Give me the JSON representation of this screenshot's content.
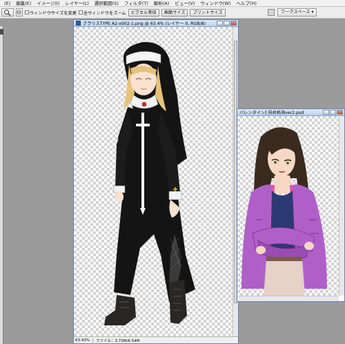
{
  "menubar": {
    "items": [
      "(E)",
      "編集(E)",
      "イメージ(I)",
      "レイヤー(L)",
      "選択範囲(S)",
      "フィルタ(T)",
      "解析(A)",
      "ビュー(V)",
      "ウィンドウ(W)",
      "ヘルプ(H)"
    ]
  },
  "options_bar": {
    "resize_windows_label": "ウィンドウサイズを変更",
    "zoom_all_label": "全ウィンドウをズーム",
    "actual_pixels_label": "ピクセル等倍",
    "fit_screen_label": "画面サイズ",
    "print_size_label": "プリントサイズ",
    "workspace_label": "ワークスペース ▾",
    "zoom_tool_icon": "magnifier-icon"
  },
  "main_document": {
    "title": "クラリスTYPE A2-x002-1.png @ 63.4% (レイヤー 0, RGB/8)",
    "status_zoom": "63.43%",
    "status_file": "ファイル：3.73M/6.54M"
  },
  "second_document": {
    "title": "バレンタイン] 向井拓海ver2.psd"
  },
  "colors": {
    "workspace_bg": "#9a9a9a",
    "title_bar": "#bcd0ea",
    "nun_habit": "#141414",
    "hair_blonde": "#e6c27a",
    "jacket_purple": "#b05fc9",
    "shirt_navy": "#2b3a73"
  }
}
